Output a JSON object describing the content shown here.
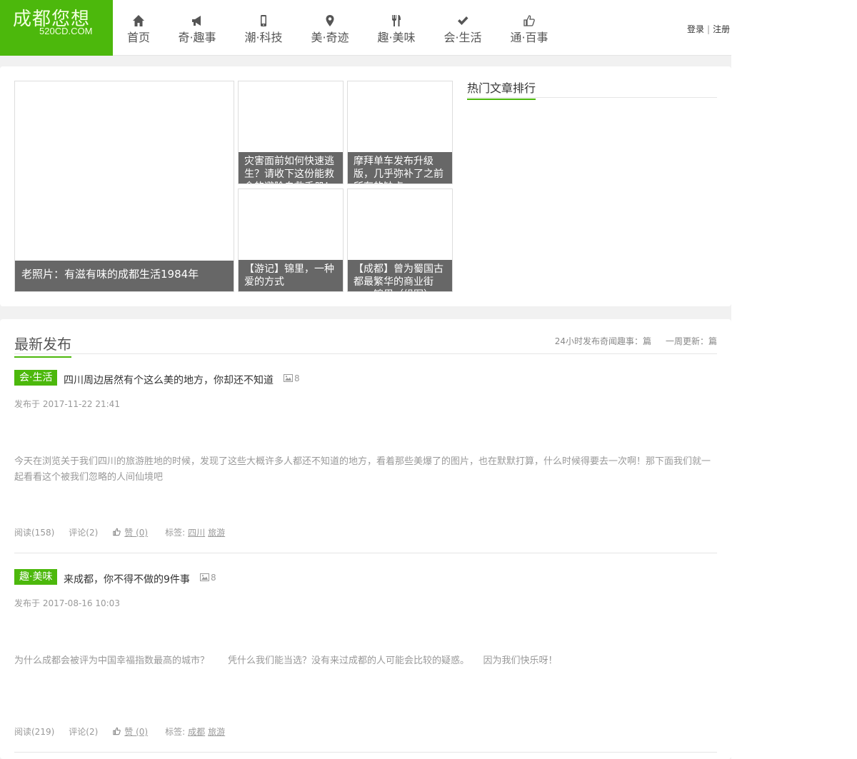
{
  "logo": {
    "mark": "成都您想",
    "sub": "520CD.COM"
  },
  "nav": [
    {
      "label": "首页",
      "icon": "home-icon"
    },
    {
      "label": "奇·趣事",
      "icon": "megaphone-icon"
    },
    {
      "label": "潮·科技",
      "icon": "mobile-icon"
    },
    {
      "label": "美·奇迹",
      "icon": "map-pin-icon"
    },
    {
      "label": "趣·美味",
      "icon": "cutlery-icon"
    },
    {
      "label": "会·生活",
      "icon": "check-icon"
    },
    {
      "label": "通·百事",
      "icon": "thumbs-up-icon"
    }
  ],
  "auth": {
    "login": "登录",
    "separator": "|",
    "register": "注册"
  },
  "featured": {
    "main": "老照片：有滋有味的成都生活1984年",
    "tiles": [
      "灾害面前如何快速逃生？请收下这份能救命的避险自救手册！",
      "摩拜单车发布升级版，几乎弥补了之前所有的缺点",
      "【游记】锦里，一种爱的方式",
      "【成都】曾为蜀国古都最繁华的商业街——锦里（组图）"
    ]
  },
  "hot": {
    "title": "热门文章排行"
  },
  "latest": {
    "title": "最新发布",
    "stat_24h": "24小时发布奇闻趣事：篇",
    "stat_week": "一周更新：篇",
    "posts": [
      {
        "category": "会·生活",
        "title": "四川周边居然有个这么美的地方，你却还不知道",
        "images": "8",
        "date": "发布于 2017-11-22 21:41",
        "excerpt": "今天在浏览关于我们四川的旅游胜地的时候，发现了这些大概许多人都还不知道的地方，看着那些美爆了的图片，也在默默打算，什么时候得要去一次啊！那下面我们就一起看看这个被我们忽略的人间仙境吧",
        "reads": "阅读(158)",
        "comments": "评论(2)",
        "likes": "赞 (0)",
        "tags_label": "标签:",
        "tag1": "四川",
        "tag2": "旅游"
      },
      {
        "category": "趣·美味",
        "title": "来成都，你不得不做的9件事",
        "images": "8",
        "date": "发布于 2017-08-16 10:03",
        "excerpt": "为什么成都会被评为中国幸福指数最高的城市？　　凭什么我们能当选？没有来过成都的人可能会比较的疑惑。　　因为我们快乐呀！",
        "reads": "阅读(219)",
        "comments": "评论(2)",
        "likes": "赞 (0)",
        "tags_label": "标签:",
        "tag1": "成都",
        "tag2": "旅游"
      }
    ]
  },
  "colors": {
    "brand": "#4cb80c",
    "caption_bg": "#5a5a5a"
  }
}
